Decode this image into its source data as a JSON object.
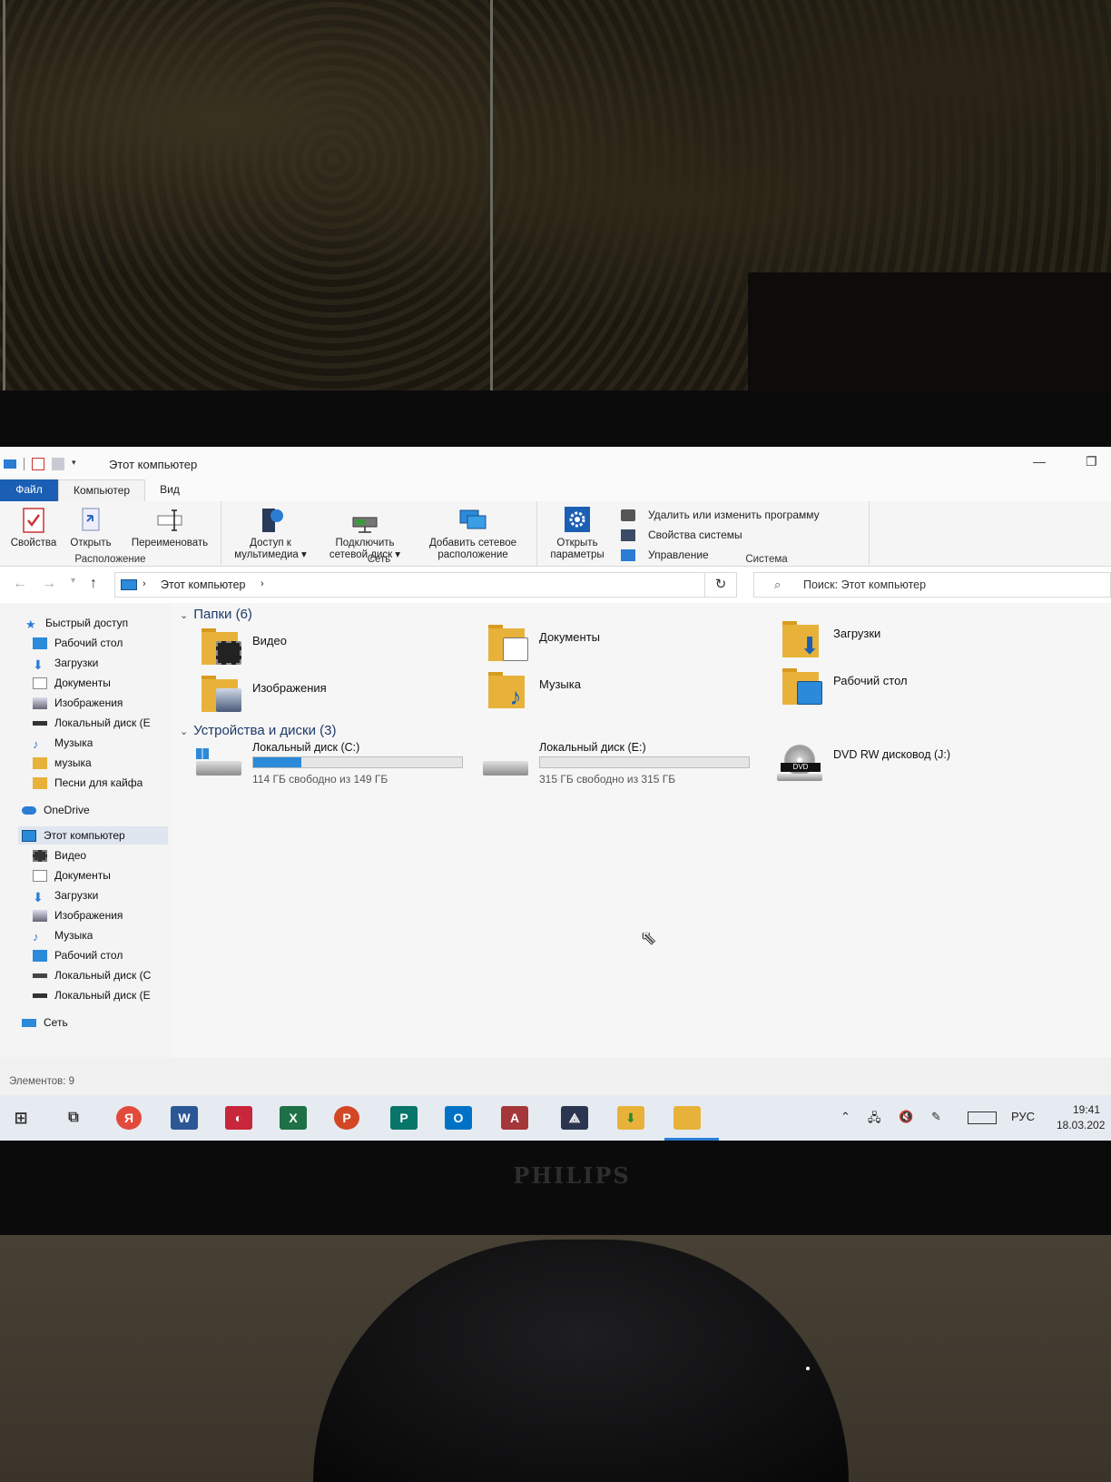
{
  "window": {
    "title": "Этот компьютер"
  },
  "ribbon": {
    "tabs": [
      "Файл",
      "Компьютер",
      "Вид"
    ],
    "groups": {
      "location": {
        "label": "Расположение",
        "buttons": [
          "Свойства",
          "Открыть",
          "Переименовать"
        ]
      },
      "network": {
        "label": "Сеть",
        "buttons": [
          {
            "line1": "Доступ к",
            "line2": "мультимедиа ▾"
          },
          {
            "line1": "Подключить",
            "line2": "сетевой диск ▾"
          },
          {
            "line1": "Добавить сетевое",
            "line2": "расположение"
          }
        ]
      },
      "system": {
        "label": "Система",
        "open_params": {
          "line1": "Открыть",
          "line2": "параметры"
        },
        "items": [
          "Удалить или изменить программу",
          "Свойства системы",
          "Управление"
        ]
      }
    }
  },
  "address": {
    "path": "Этот компьютер",
    "search_placeholder": "Поиск: Этот компьютер"
  },
  "sidebar": {
    "quick_access": "Быстрый доступ",
    "quick_items": [
      "Рабочий стол",
      "Загрузки",
      "Документы",
      "Изображения",
      "Локальный диск (E",
      "Музыка",
      "музыка",
      "Песни для кайфа"
    ],
    "onedrive": "OneDrive",
    "this_pc": "Этот компьютер",
    "pc_items": [
      "Видео",
      "Документы",
      "Загрузки",
      "Изображения",
      "Музыка",
      "Рабочий стол",
      "Локальный диск (C",
      "Локальный диск (E"
    ],
    "network": "Сеть"
  },
  "folders": {
    "header": "Папки (6)",
    "items": [
      "Видео",
      "Документы",
      "Загрузки",
      "Изображения",
      "Музыка",
      "Рабочий стол"
    ]
  },
  "drives": {
    "header": "Устройства и диски (3)",
    "items": [
      {
        "name": "Локальный диск (C:)",
        "free": "114 ГБ свободно из 149 ГБ",
        "used_fraction": 0.23
      },
      {
        "name": "Локальный диск (E:)",
        "free": "315 ГБ свободно из 315 ГБ",
        "used_fraction": 0.0
      },
      {
        "name": "DVD RW дисковод (J:)"
      }
    ]
  },
  "status": {
    "count": "Элементов: 9"
  },
  "taskbar": {
    "language": "РУС",
    "time": "19:41",
    "date": "18.03.202"
  },
  "monitor": {
    "brand": "PHILIPS"
  },
  "colors": {
    "accent": "#1a5fb4",
    "folder": "#e8b23a",
    "progress": "#2b8ad9"
  }
}
